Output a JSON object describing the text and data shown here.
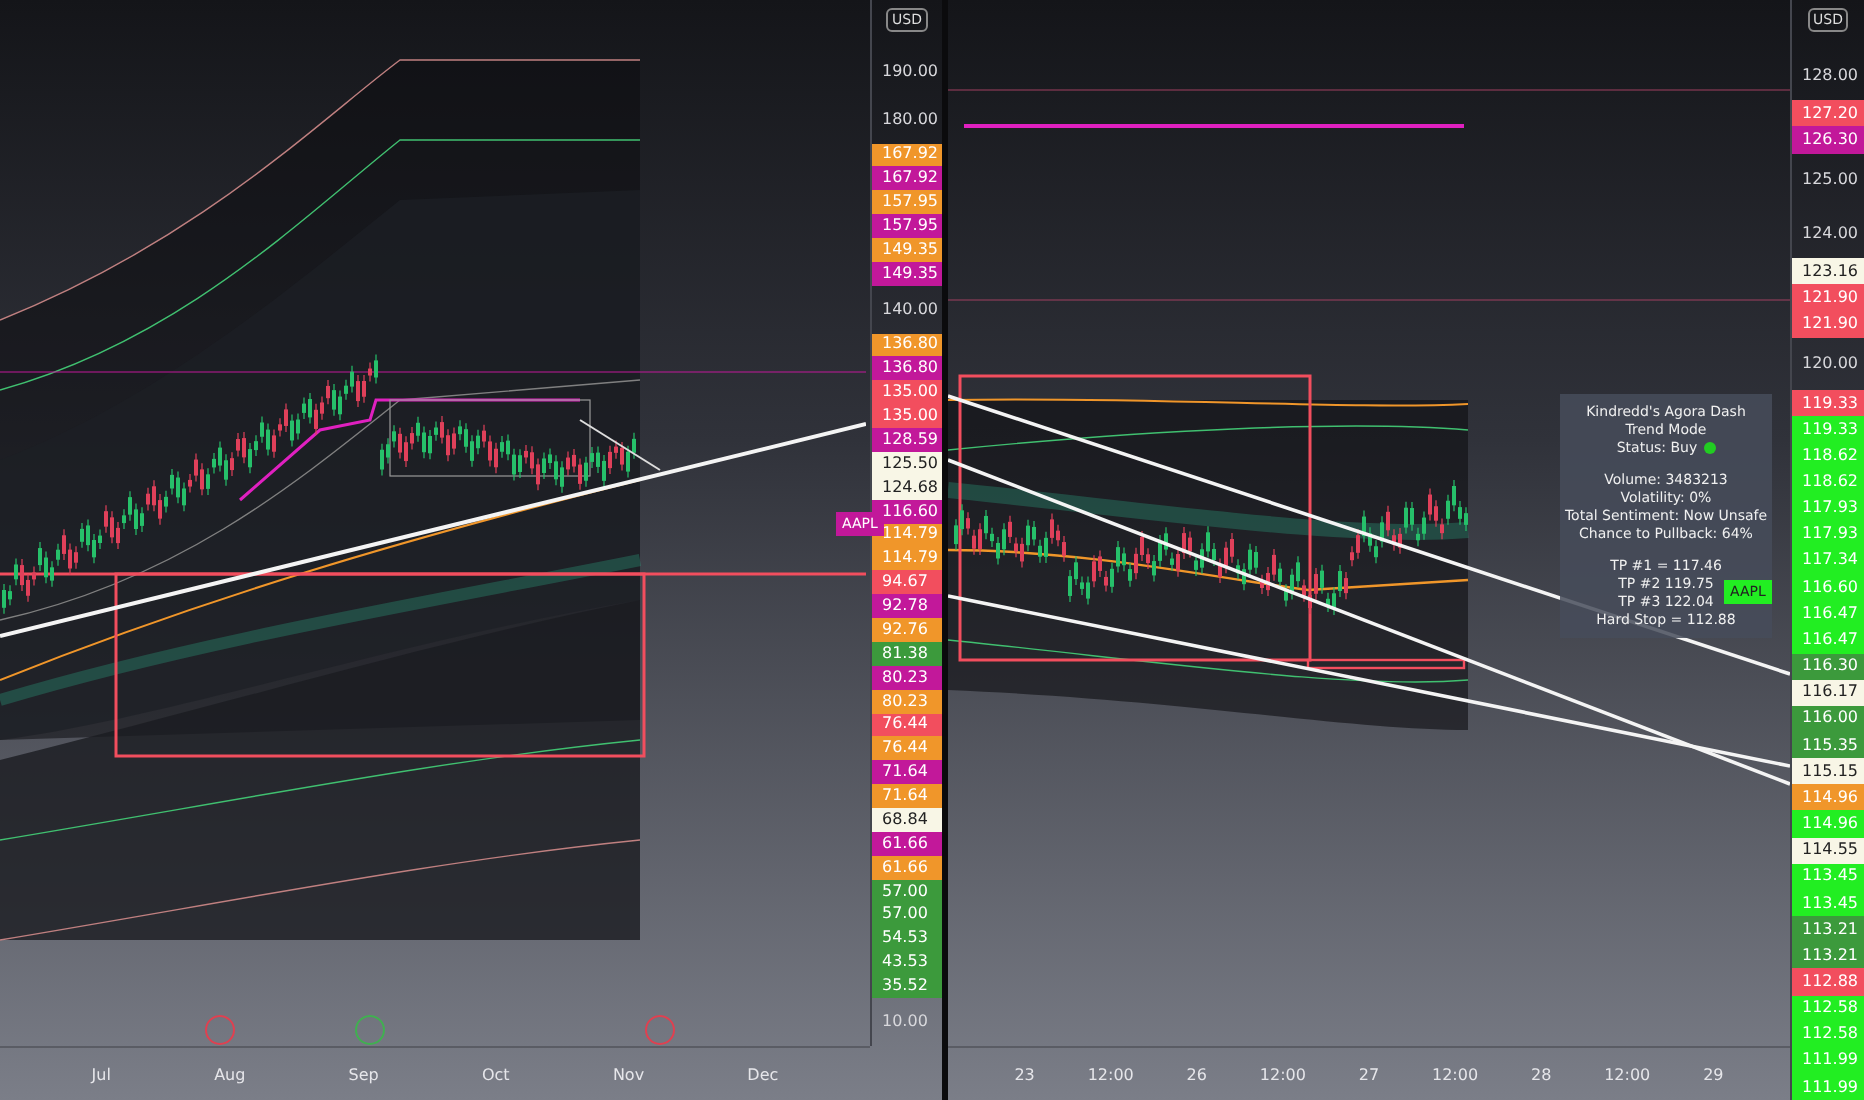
{
  "left_pane": {
    "price_axis": {
      "currency": "USD",
      "labels": [
        {
          "text": "190.00",
          "kind": "plain"
        },
        {
          "text": "180.00",
          "kind": "plain"
        },
        {
          "text": "167.92",
          "kind": "tag",
          "color": "#f0962a"
        },
        {
          "text": "167.92",
          "kind": "tag",
          "color": "#c2189a"
        },
        {
          "text": "157.95",
          "kind": "tag",
          "color": "#f0962a"
        },
        {
          "text": "157.95",
          "kind": "tag",
          "color": "#c2189a"
        },
        {
          "text": "149.35",
          "kind": "tag",
          "color": "#f0962a"
        },
        {
          "text": "149.35",
          "kind": "tag",
          "color": "#c2189a"
        },
        {
          "text": "140.00",
          "kind": "plain"
        },
        {
          "text": "136.80",
          "kind": "tag",
          "color": "#f0962a"
        },
        {
          "text": "136.80",
          "kind": "tag",
          "color": "#c2189a"
        },
        {
          "text": "135.00",
          "kind": "tag",
          "color": "#f24e5e"
        },
        {
          "text": "135.00",
          "kind": "tag",
          "color": "#f24e5e"
        },
        {
          "text": "128.59",
          "kind": "tag",
          "color": "#c2189a"
        },
        {
          "text": "125.50",
          "kind": "tag",
          "color": "#f8f6e6"
        },
        {
          "text": "124.68",
          "kind": "tag",
          "color": "#f8f6e6"
        },
        {
          "text": "116.60",
          "kind": "tag",
          "color": "#c2189a"
        },
        {
          "text": "114.79",
          "kind": "tag",
          "color": "#f0962a"
        },
        {
          "text": "114.79",
          "kind": "tag",
          "color": "#f0962a"
        },
        {
          "text": "94.67",
          "kind": "tag",
          "color": "#f24e5e"
        },
        {
          "text": "92.78",
          "kind": "tag",
          "color": "#c2189a"
        },
        {
          "text": "92.76",
          "kind": "tag",
          "color": "#f0962a"
        },
        {
          "text": "81.38",
          "kind": "tag",
          "color": "#3c9a3c"
        },
        {
          "text": "80.23",
          "kind": "tag",
          "color": "#c2189a"
        },
        {
          "text": "80.23",
          "kind": "tag",
          "color": "#f0962a"
        },
        {
          "text": "76.44",
          "kind": "tag",
          "color": "#f24e5e"
        },
        {
          "text": "76.44",
          "kind": "tag",
          "color": "#f0962a"
        },
        {
          "text": "71.64",
          "kind": "tag",
          "color": "#c2189a"
        },
        {
          "text": "71.64",
          "kind": "tag",
          "color": "#f0962a"
        },
        {
          "text": "68.84",
          "kind": "tag",
          "color": "#f8f6e6"
        },
        {
          "text": "61.66",
          "kind": "tag",
          "color": "#c2189a"
        },
        {
          "text": "61.66",
          "kind": "tag",
          "color": "#f0962a"
        },
        {
          "text": "57.00",
          "kind": "tag",
          "color": "#3c9a3c"
        },
        {
          "text": "57.00",
          "kind": "tag",
          "color": "#3c9a3c"
        },
        {
          "text": "54.53",
          "kind": "tag",
          "color": "#3c9a3c"
        },
        {
          "text": "43.53",
          "kind": "tag",
          "color": "#3c9a3c"
        },
        {
          "text": "35.52",
          "kind": "tag",
          "color": "#3c9a3c"
        },
        {
          "text": "10.00",
          "kind": "plain"
        }
      ]
    },
    "symbol_tag": "AAPL",
    "time_axis": [
      "Jul",
      "Aug",
      "Sep",
      "Oct",
      "Nov",
      "Dec"
    ]
  },
  "right_pane": {
    "price_axis": {
      "currency": "USD",
      "labels": [
        {
          "text": "128.00",
          "kind": "plain"
        },
        {
          "text": "127.20",
          "kind": "tag",
          "color": "#f24e5e"
        },
        {
          "text": "126.30",
          "kind": "tag",
          "color": "#c2189a"
        },
        {
          "text": "125.00",
          "kind": "plain"
        },
        {
          "text": "124.00",
          "kind": "plain"
        },
        {
          "text": "123.16",
          "kind": "tag",
          "color": "#f8f6e6"
        },
        {
          "text": "121.90",
          "kind": "tag",
          "color": "#f24e5e"
        },
        {
          "text": "121.90",
          "kind": "tag",
          "color": "#f24e5e"
        },
        {
          "text": "120.00",
          "kind": "plain"
        },
        {
          "text": "119.33",
          "kind": "tag",
          "color": "#f24e5e"
        },
        {
          "text": "119.33",
          "kind": "tag",
          "color": "#22ee22"
        },
        {
          "text": "118.62",
          "kind": "tag",
          "color": "#22ee22"
        },
        {
          "text": "118.62",
          "kind": "tag",
          "color": "#22ee22"
        },
        {
          "text": "117.93",
          "kind": "tag",
          "color": "#22ee22"
        },
        {
          "text": "117.93",
          "kind": "tag",
          "color": "#22ee22"
        },
        {
          "text": "117.34",
          "kind": "tag",
          "color": "#22ee22"
        },
        {
          "text": "116.60",
          "kind": "tag",
          "color": "#22ee22"
        },
        {
          "text": "116.47",
          "kind": "tag",
          "color": "#22ee22"
        },
        {
          "text": "116.47",
          "kind": "tag",
          "color": "#22ee22"
        },
        {
          "text": "116.30",
          "kind": "tag",
          "color": "#3c9a3c"
        },
        {
          "text": "116.17",
          "kind": "tag",
          "color": "#f8f6e6"
        },
        {
          "text": "116.00",
          "kind": "tag",
          "color": "#3c9a3c"
        },
        {
          "text": "115.35",
          "kind": "tag",
          "color": "#3c9a3c"
        },
        {
          "text": "115.15",
          "kind": "tag",
          "color": "#f8f6e6"
        },
        {
          "text": "114.96",
          "kind": "tag",
          "color": "#f0962a"
        },
        {
          "text": "114.96",
          "kind": "tag",
          "color": "#22ee22"
        },
        {
          "text": "114.55",
          "kind": "tag",
          "color": "#f8f6e6"
        },
        {
          "text": "113.45",
          "kind": "tag",
          "color": "#22ee22"
        },
        {
          "text": "113.45",
          "kind": "tag",
          "color": "#22ee22"
        },
        {
          "text": "113.21",
          "kind": "tag",
          "color": "#3c9a3c"
        },
        {
          "text": "113.21",
          "kind": "tag",
          "color": "#3c9a3c"
        },
        {
          "text": "112.88",
          "kind": "tag",
          "color": "#f24e5e"
        },
        {
          "text": "112.58",
          "kind": "tag",
          "color": "#22ee22"
        },
        {
          "text": "112.58",
          "kind": "tag",
          "color": "#22ee22"
        },
        {
          "text": "111.99",
          "kind": "tag",
          "color": "#22ee22"
        },
        {
          "text": "111.99",
          "kind": "tag",
          "color": "#22ee22"
        }
      ]
    },
    "symbol_tag": "AAPL",
    "time_axis": [
      "23",
      "12:00",
      "26",
      "12:00",
      "27",
      "12:00",
      "28",
      "12:00",
      "29"
    ],
    "dashboard": {
      "lines": [
        {
          "text": "Kindredd's Agora Dash"
        },
        {
          "text": "Trend Mode"
        },
        {
          "text": "Status: Buy",
          "dot": true
        },
        {
          "text": "Volume: 3483213",
          "gap_before": true
        },
        {
          "text": "Volatility: 0%"
        },
        {
          "text": "Total Sentiment: Now Unsafe"
        },
        {
          "text": "Chance to Pullback: 64%"
        },
        {
          "text": "TP #1 = 117.46",
          "gap_before": true
        },
        {
          "text": "TP #2 119.75"
        },
        {
          "text": "TP #3 122.04"
        },
        {
          "text": "Hard Stop = 112.88"
        }
      ]
    }
  }
}
